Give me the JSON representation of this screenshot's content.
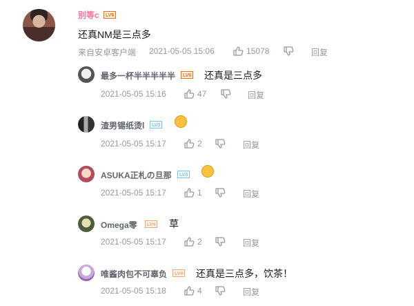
{
  "main": {
    "username": "别等c",
    "level": "LV6",
    "text": "还真NM是三点多",
    "source": "来自安卓客户端",
    "timestamp": "2021-05-05 15:06",
    "likes": "15078",
    "reply_label": "回复"
  },
  "replies": [
    {
      "username": "最多一杯半半半半半",
      "level": "LV6",
      "text": "还真是三点多",
      "timestamp": "2021-05-05 15:16",
      "likes": "47",
      "reply_label": "回复"
    },
    {
      "username": "渣男锡纸烫l",
      "level": "LV3",
      "text": "",
      "emoji": "cat-emoji",
      "timestamp": "2021-05-05 15:17",
      "likes": "2",
      "reply_label": "回复"
    },
    {
      "username": "ASUKA正札の旦那",
      "level": "LV3",
      "text": "",
      "emoji": "sleepy-emoji",
      "timestamp": "2021-05-05 15:17",
      "likes": "1",
      "reply_label": "回复"
    },
    {
      "username": "Omega零",
      "level": "LV4",
      "text": "草",
      "timestamp": "2021-05-05 15:17",
      "likes": "2",
      "reply_label": "回复"
    },
    {
      "username": "唯酱肉包不可辜负",
      "level": "LV4",
      "text": "还真是三点多，饮茶！",
      "timestamp": "2021-05-05 15:18",
      "likes": "4",
      "reply_label": "回复"
    }
  ],
  "colors": {
    "username_pink": "#fb7299",
    "meta_gray": "#9499a0",
    "lv6": "#ff6a00",
    "lv3": "#7bc4e8",
    "lv4": "#f3a56b"
  }
}
